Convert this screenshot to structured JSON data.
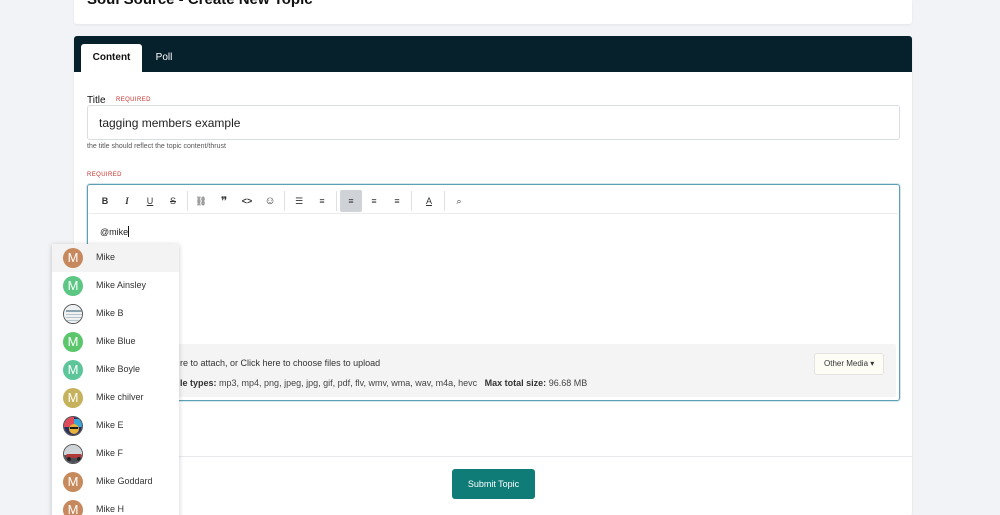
{
  "page": {
    "title": "Soul Source - Create New Topic"
  },
  "tabs": [
    {
      "label": "Content"
    },
    {
      "label": "Poll"
    }
  ],
  "form": {
    "title_label": "Title",
    "required_text": "REQUIRED",
    "title_value": "tagging members example",
    "title_help": "the title should reflect the topic content/thrust",
    "content_required_text": "REQUIRED"
  },
  "editor": {
    "text": "@mike",
    "toolbar": [
      {
        "icon": "bold-icon",
        "glyph": "B"
      },
      {
        "icon": "italic-icon",
        "glyph": "I"
      },
      {
        "icon": "underline-icon",
        "glyph": "U"
      },
      {
        "icon": "strikethrough-icon",
        "glyph": "S"
      },
      {
        "icon": "link-icon",
        "glyph": "⛓"
      },
      {
        "icon": "quote-icon",
        "glyph": "❞"
      },
      {
        "icon": "code-icon",
        "glyph": "<>"
      },
      {
        "icon": "emoji-icon",
        "glyph": "☺"
      },
      {
        "icon": "bullet-list-icon",
        "glyph": "☰"
      },
      {
        "icon": "numbered-list-icon",
        "glyph": "≡"
      },
      {
        "icon": "align-left-icon",
        "glyph": "≡"
      },
      {
        "icon": "align-center-icon",
        "glyph": "≡"
      },
      {
        "icon": "align-right-icon",
        "glyph": "≡"
      },
      {
        "icon": "text-color-icon",
        "glyph": "A"
      },
      {
        "icon": "preview-icon",
        "glyph": "⌕"
      }
    ]
  },
  "attachments": {
    "drop_text": "re to attach, or Click here to choose files to upload",
    "types_label": "le types:",
    "types_value": "mp3, mp4, png, jpeg, jpg, gif, pdf, flv, wmv, wma, wav, m4a, hevc",
    "max_label": "Max total size:",
    "max_value": "96.68 MB",
    "other_media_label": "Other Media ▾"
  },
  "submit_label": "Submit Topic",
  "mentions": [
    {
      "name": "Mike",
      "letter": "M",
      "color": "#c6885c"
    },
    {
      "name": "Mike Ainsley",
      "letter": "M",
      "color": "#5cc683"
    },
    {
      "name": "Mike B",
      "letter": "",
      "color": "#d8dde0"
    },
    {
      "name": "Mike Blue",
      "letter": "M",
      "color": "#5cc66d"
    },
    {
      "name": "Mike Boyle",
      "letter": "M",
      "color": "#5cc69a"
    },
    {
      "name": "Mike chilver",
      "letter": "M",
      "color": "#c6b15c"
    },
    {
      "name": "Mike E",
      "letter": "",
      "color": "#3b3b6e"
    },
    {
      "name": "Mike F",
      "letter": "",
      "color": "#6b6b6b"
    },
    {
      "name": "Mike Goddard",
      "letter": "M",
      "color": "#c68a5c"
    },
    {
      "name": "Mike H",
      "letter": "M",
      "color": "#c6885c"
    }
  ]
}
